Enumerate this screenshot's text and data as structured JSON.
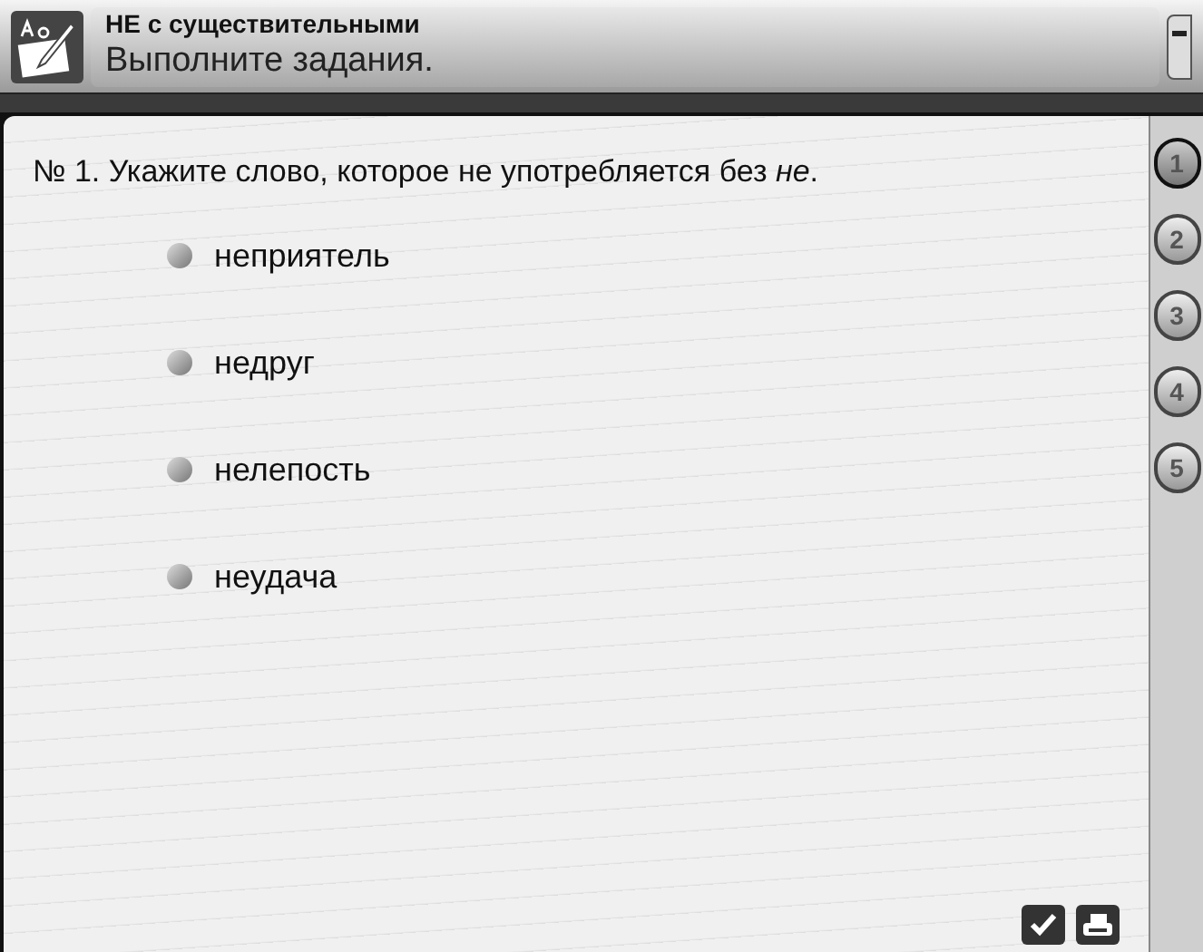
{
  "header": {
    "title": "НЕ с существительными",
    "subtitle": "Выполните задания."
  },
  "question": {
    "text": "№ 1. Укажите слово, которое не употребляется без *не*.",
    "options": [
      {
        "label": "неприятель",
        "selected": false
      },
      {
        "label": "недруг",
        "selected": false
      },
      {
        "label": "нелепость",
        "selected": false
      },
      {
        "label": "неудача",
        "selected": false
      }
    ]
  },
  "task_tabs": [
    {
      "label": "1",
      "selected": true
    },
    {
      "label": "2",
      "selected": false
    },
    {
      "label": "3",
      "selected": false
    },
    {
      "label": "4",
      "selected": false
    },
    {
      "label": "5",
      "selected": false
    }
  ]
}
